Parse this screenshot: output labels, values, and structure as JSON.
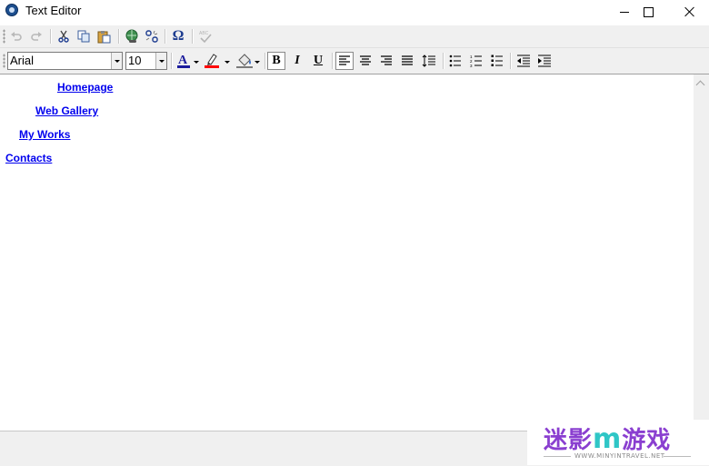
{
  "window": {
    "title": "Text Editor"
  },
  "toolbar2": {
    "font_name": "Arial",
    "font_size": "10",
    "bold_label": "B",
    "italic_label": "I",
    "underline_label": "U"
  },
  "icons": {
    "toolbar1": [
      "undo-icon",
      "redo-icon",
      "cut-icon",
      "copy-icon",
      "paste-icon",
      "insert-link-icon",
      "remove-link-icon",
      "special-character-icon",
      "spell-check-icon"
    ],
    "toolbar2": [
      "font-color-icon",
      "highlight-color-icon",
      "fill-color-icon",
      "align-left-icon",
      "align-center-icon",
      "align-right-icon",
      "justify-icon",
      "line-spacing-icon",
      "bullet-list-icon",
      "numbered-list-icon",
      "multilevel-list-icon",
      "decrease-indent-icon",
      "increase-indent-icon"
    ]
  },
  "colors": {
    "font_color": "#1c1c9c",
    "highlight_color": "#ff0000",
    "link_color": "#0000ee"
  },
  "document": {
    "links": [
      "Homepage",
      "Web Gallery",
      "My Works",
      "Contacts"
    ]
  },
  "watermark": {
    "text_part1": "迷影",
    "text_part2": "游戏",
    "subtitle": "WWW.MINYINTRAVEL.NET"
  }
}
